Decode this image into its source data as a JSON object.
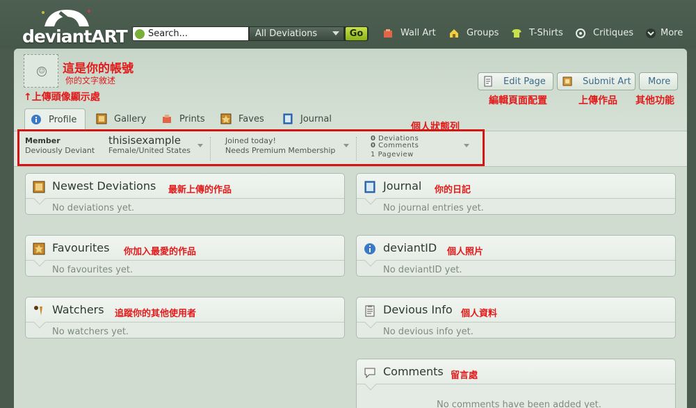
{
  "header": {
    "logo_text": "deviantART",
    "search": {
      "placeholder": "Search...",
      "scope": "All Deviations",
      "go_label": "Go"
    },
    "nav": [
      {
        "label": "Wall Art",
        "icon": "wall-art-icon"
      },
      {
        "label": "Groups",
        "icon": "groups-icon"
      },
      {
        "label": "T-Shirts",
        "icon": "tshirt-icon"
      },
      {
        "label": "Critiques",
        "icon": "critiques-icon"
      },
      {
        "label": "More",
        "icon": "more-icon"
      }
    ]
  },
  "profile": {
    "annotations": {
      "account": "這是你的帳號",
      "tagline": "你的文字敘述",
      "avatar": "↑上傳頭像顯示處",
      "edit_page": "編輯頁面配置",
      "submit_art": "上傳作品",
      "more": "其他功能",
      "status_bar": "個人狀態列"
    },
    "buttons": {
      "edit_page": "Edit Page",
      "submit_art": "Submit Art",
      "more": "More"
    },
    "tabs": [
      {
        "label": "Profile",
        "icon": "info-icon",
        "active": true
      },
      {
        "label": "Gallery",
        "icon": "gallery-icon"
      },
      {
        "label": "Prints",
        "icon": "prints-icon"
      },
      {
        "label": "Faves",
        "icon": "faves-icon"
      },
      {
        "label": "Journal",
        "icon": "journal-icon"
      }
    ],
    "status": {
      "member_label": "Member",
      "member_type": "Deviously Deviant",
      "username": "thisisexample",
      "details": "Female/United States",
      "joined": "Joined today!",
      "membership": "Needs Premium Membership",
      "stats": [
        {
          "count": "0",
          "label": "Deviations"
        },
        {
          "count": "0",
          "label": "Comments"
        },
        {
          "count": "1",
          "label": "Pageview"
        }
      ]
    }
  },
  "boxes": {
    "newest": {
      "title": "Newest Deviations",
      "annotation": "最新上傳的作品",
      "empty": "No deviations yet.",
      "icon": "deviations-icon"
    },
    "favourites": {
      "title": "Favourites",
      "annotation": "你加入最愛的作品",
      "empty": "No favourites yet.",
      "icon": "favourites-icon"
    },
    "watchers": {
      "title": "Watchers",
      "annotation": "追蹤你的其他使用者",
      "empty": "No watchers yet.",
      "icon": "watchers-icon"
    },
    "journal": {
      "title": "Journal",
      "annotation": "你的日記",
      "empty": "No journal entries yet.",
      "icon": "journal-icon"
    },
    "deviantid": {
      "title": "deviantID",
      "annotation": "個人照片",
      "empty": "No deviantID yet.",
      "icon": "info-icon"
    },
    "devious_info": {
      "title": "Devious Info",
      "annotation": "個人資料",
      "empty": "No devious info yet.",
      "icon": "clipboard-icon"
    },
    "comments": {
      "title": "Comments",
      "annotation": "留言處",
      "empty": "No comments have been added yet.",
      "icon": "speech-bubble-icon"
    }
  },
  "colors": {
    "annotation_red": "#e31a1a",
    "highlight_border": "#d71414",
    "go_button": "#a6c82a",
    "link_blue": "#3b6b8a"
  }
}
